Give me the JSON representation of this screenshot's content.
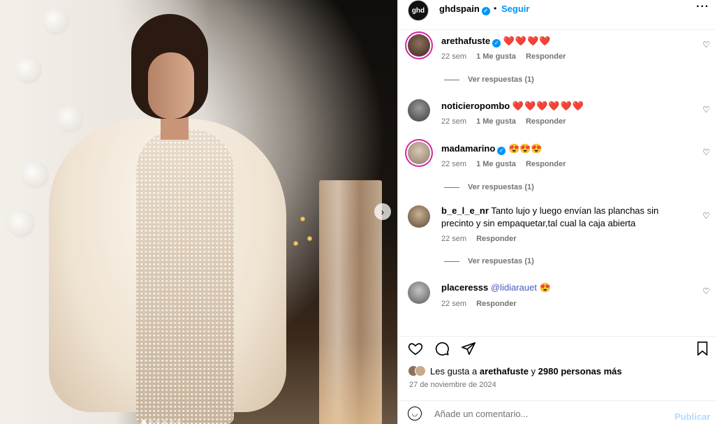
{
  "post": {
    "brand_avatar_text": "ghd",
    "username": "ghdspain",
    "separator": "•",
    "follow_label": "Seguir",
    "more_label": "···",
    "carousel_next": "›",
    "carousel_dots": 6
  },
  "comments": [
    {
      "user": "arethafuste",
      "verified": true,
      "text": "❤️❤️❤️❤️",
      "time": "22 sem",
      "likes": "1 Me gusta",
      "reply": "Responder",
      "view_replies": "Ver respuestas (1)"
    },
    {
      "user": "noticieropombo",
      "verified": false,
      "text": "❤️❤️❤️❤️❤️❤️",
      "time": "22 sem",
      "likes": "1 Me gusta",
      "reply": "Responder",
      "view_replies": ""
    },
    {
      "user": "madamarino",
      "verified": true,
      "text": "😍😍😍",
      "time": "22 sem",
      "likes": "1 Me gusta",
      "reply": "Responder",
      "view_replies": "Ver respuestas (1)"
    },
    {
      "user": "b_e_l_e_nr",
      "verified": false,
      "text": "Tanto lujo y luego envían las planchas sin precinto y sin empaquetar,tal cual la caja abierta",
      "time": "22 sem",
      "likes": "",
      "reply": "Responder",
      "view_replies": "Ver respuestas (1)"
    },
    {
      "user": "placeresss",
      "verified": false,
      "mention": "@lidiarauet",
      "text": "😍",
      "time": "22 sem",
      "likes": "",
      "reply": "Responder",
      "view_replies": ""
    }
  ],
  "likes_summary": {
    "prefix": "Les gusta a",
    "user": "arethafuste",
    "connector": "y",
    "count": "2980 personas más"
  },
  "date": "27 de noviembre de 2024",
  "add_comment": {
    "placeholder": "Añade un comentario...",
    "publish_label": "Publicar"
  },
  "icons": {
    "like": "heart-icon",
    "comment": "comment-icon",
    "share": "share-icon",
    "save": "bookmark-icon",
    "emoji": "emoji-icon"
  },
  "colors": {
    "link_blue": "#0095f6",
    "verified_blue": "#0095f6",
    "muted_gray": "#737373",
    "publish_disabled": "#b3dbff",
    "mention": "#4a5ab8"
  }
}
